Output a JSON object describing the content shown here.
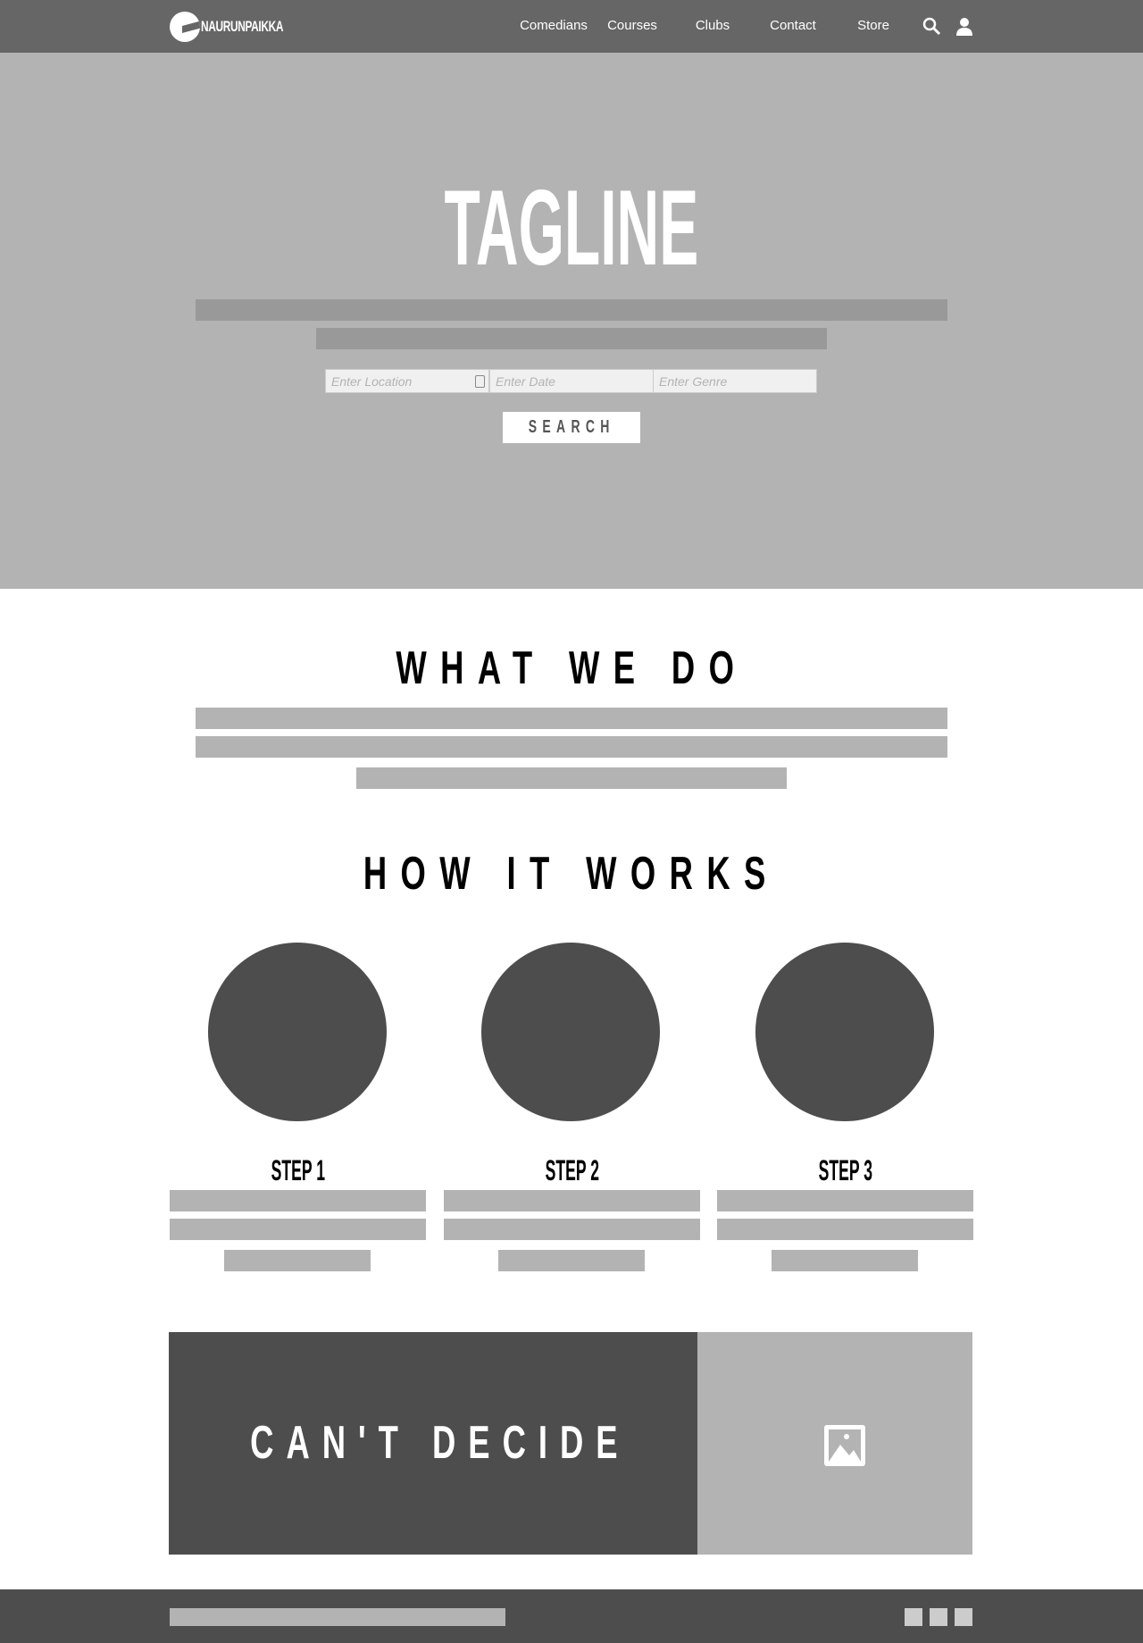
{
  "header": {
    "brand": "NAURUNPAIKKA",
    "nav": [
      "Comedians",
      "Courses",
      "Clubs",
      "Contact",
      "Store"
    ]
  },
  "hero": {
    "tagline": "TAGLINE",
    "search": {
      "location_placeholder": "Enter Location",
      "date_placeholder": "Enter Date",
      "genre_placeholder": "Enter Genre",
      "button": "SEARCH"
    }
  },
  "what_we_do": {
    "title": "WHAT WE DO"
  },
  "how_it_works": {
    "title": "HOW IT WORKS",
    "steps": [
      {
        "label": "STEP 1"
      },
      {
        "label": "STEP 2"
      },
      {
        "label": "STEP 3"
      }
    ]
  },
  "cta": {
    "title": "CAN'T DECIDE"
  },
  "colors": {
    "header": "#666666",
    "hero": "#b3b3b3",
    "dark": "#4d4d4d"
  }
}
